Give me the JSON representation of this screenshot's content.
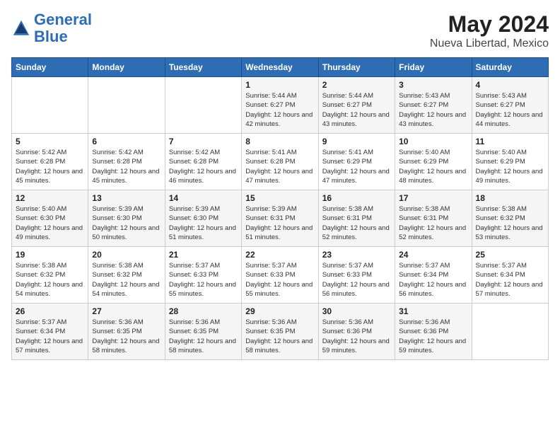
{
  "logo": {
    "line1": "General",
    "line2": "Blue"
  },
  "header": {
    "month_year": "May 2024",
    "location": "Nueva Libertad, Mexico"
  },
  "weekdays": [
    "Sunday",
    "Monday",
    "Tuesday",
    "Wednesday",
    "Thursday",
    "Friday",
    "Saturday"
  ],
  "weeks": [
    [
      {
        "day": null
      },
      {
        "day": null
      },
      {
        "day": null
      },
      {
        "day": "1",
        "sunrise": "5:44 AM",
        "sunset": "6:27 PM",
        "daylight": "12 hours and 42 minutes."
      },
      {
        "day": "2",
        "sunrise": "5:44 AM",
        "sunset": "6:27 PM",
        "daylight": "12 hours and 43 minutes."
      },
      {
        "day": "3",
        "sunrise": "5:43 AM",
        "sunset": "6:27 PM",
        "daylight": "12 hours and 43 minutes."
      },
      {
        "day": "4",
        "sunrise": "5:43 AM",
        "sunset": "6:27 PM",
        "daylight": "12 hours and 44 minutes."
      }
    ],
    [
      {
        "day": "5",
        "sunrise": "5:42 AM",
        "sunset": "6:28 PM",
        "daylight": "12 hours and 45 minutes."
      },
      {
        "day": "6",
        "sunrise": "5:42 AM",
        "sunset": "6:28 PM",
        "daylight": "12 hours and 45 minutes."
      },
      {
        "day": "7",
        "sunrise": "5:42 AM",
        "sunset": "6:28 PM",
        "daylight": "12 hours and 46 minutes."
      },
      {
        "day": "8",
        "sunrise": "5:41 AM",
        "sunset": "6:28 PM",
        "daylight": "12 hours and 47 minutes."
      },
      {
        "day": "9",
        "sunrise": "5:41 AM",
        "sunset": "6:29 PM",
        "daylight": "12 hours and 47 minutes."
      },
      {
        "day": "10",
        "sunrise": "5:40 AM",
        "sunset": "6:29 PM",
        "daylight": "12 hours and 48 minutes."
      },
      {
        "day": "11",
        "sunrise": "5:40 AM",
        "sunset": "6:29 PM",
        "daylight": "12 hours and 49 minutes."
      }
    ],
    [
      {
        "day": "12",
        "sunrise": "5:40 AM",
        "sunset": "6:30 PM",
        "daylight": "12 hours and 49 minutes."
      },
      {
        "day": "13",
        "sunrise": "5:39 AM",
        "sunset": "6:30 PM",
        "daylight": "12 hours and 50 minutes."
      },
      {
        "day": "14",
        "sunrise": "5:39 AM",
        "sunset": "6:30 PM",
        "daylight": "12 hours and 51 minutes."
      },
      {
        "day": "15",
        "sunrise": "5:39 AM",
        "sunset": "6:31 PM",
        "daylight": "12 hours and 51 minutes."
      },
      {
        "day": "16",
        "sunrise": "5:38 AM",
        "sunset": "6:31 PM",
        "daylight": "12 hours and 52 minutes."
      },
      {
        "day": "17",
        "sunrise": "5:38 AM",
        "sunset": "6:31 PM",
        "daylight": "12 hours and 52 minutes."
      },
      {
        "day": "18",
        "sunrise": "5:38 AM",
        "sunset": "6:32 PM",
        "daylight": "12 hours and 53 minutes."
      }
    ],
    [
      {
        "day": "19",
        "sunrise": "5:38 AM",
        "sunset": "6:32 PM",
        "daylight": "12 hours and 54 minutes."
      },
      {
        "day": "20",
        "sunrise": "5:38 AM",
        "sunset": "6:32 PM",
        "daylight": "12 hours and 54 minutes."
      },
      {
        "day": "21",
        "sunrise": "5:37 AM",
        "sunset": "6:33 PM",
        "daylight": "12 hours and 55 minutes."
      },
      {
        "day": "22",
        "sunrise": "5:37 AM",
        "sunset": "6:33 PM",
        "daylight": "12 hours and 55 minutes."
      },
      {
        "day": "23",
        "sunrise": "5:37 AM",
        "sunset": "6:33 PM",
        "daylight": "12 hours and 56 minutes."
      },
      {
        "day": "24",
        "sunrise": "5:37 AM",
        "sunset": "6:34 PM",
        "daylight": "12 hours and 56 minutes."
      },
      {
        "day": "25",
        "sunrise": "5:37 AM",
        "sunset": "6:34 PM",
        "daylight": "12 hours and 57 minutes."
      }
    ],
    [
      {
        "day": "26",
        "sunrise": "5:37 AM",
        "sunset": "6:34 PM",
        "daylight": "12 hours and 57 minutes."
      },
      {
        "day": "27",
        "sunrise": "5:36 AM",
        "sunset": "6:35 PM",
        "daylight": "12 hours and 58 minutes."
      },
      {
        "day": "28",
        "sunrise": "5:36 AM",
        "sunset": "6:35 PM",
        "daylight": "12 hours and 58 minutes."
      },
      {
        "day": "29",
        "sunrise": "5:36 AM",
        "sunset": "6:35 PM",
        "daylight": "12 hours and 58 minutes."
      },
      {
        "day": "30",
        "sunrise": "5:36 AM",
        "sunset": "6:36 PM",
        "daylight": "12 hours and 59 minutes."
      },
      {
        "day": "31",
        "sunrise": "5:36 AM",
        "sunset": "6:36 PM",
        "daylight": "12 hours and 59 minutes."
      },
      {
        "day": null
      }
    ]
  ]
}
